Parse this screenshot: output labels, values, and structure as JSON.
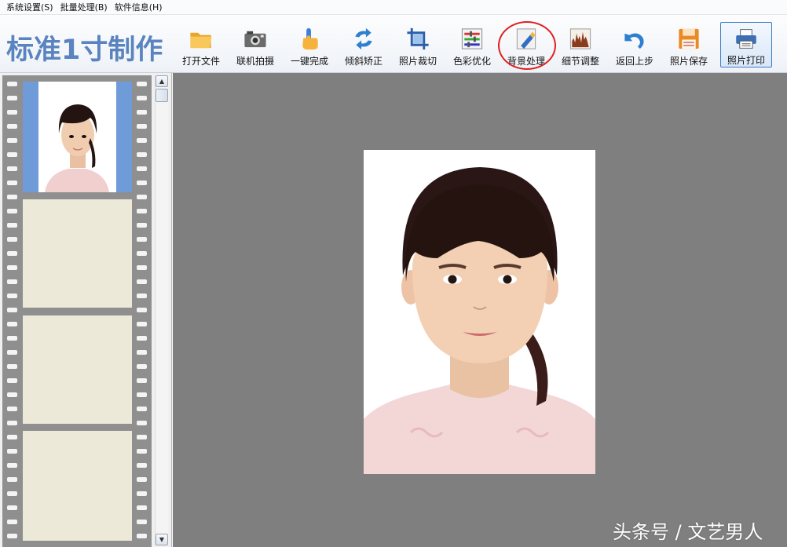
{
  "menu": {
    "items": [
      "系统设置(S)",
      "批量处理(B)",
      "软件信息(H)"
    ]
  },
  "toolbar": {
    "app_title": "标准1寸制作",
    "buttons": [
      {
        "label": "打开文件",
        "icon": "open-folder-icon"
      },
      {
        "label": "联机拍摄",
        "icon": "camera-icon"
      },
      {
        "label": "一键完成",
        "icon": "hand-pointer-icon"
      },
      {
        "label": "倾斜矫正",
        "icon": "rotate-arrows-icon"
      },
      {
        "label": "照片裁切",
        "icon": "crop-icon"
      },
      {
        "label": "色彩优化",
        "icon": "color-levels-icon"
      },
      {
        "label": "背景处理",
        "icon": "paint-brush-icon"
      },
      {
        "label": "细节调整",
        "icon": "histogram-icon"
      },
      {
        "label": "返回上步",
        "icon": "undo-arrow-icon"
      },
      {
        "label": "照片保存",
        "icon": "floppy-disk-icon"
      },
      {
        "label": "照片打印",
        "icon": "printer-icon"
      }
    ],
    "highlighted_button": "背景处理",
    "active_button": "照片打印"
  },
  "colors": {
    "title_blue": "#5a84bf",
    "thumb_background": "#6f9bd8",
    "canvas_gray": "#7f7f7f",
    "highlight_red": "#e02020"
  },
  "filmstrip": {
    "frame_count": 4,
    "filled_frames": 1
  },
  "watermark": "头条号 / 文艺男人"
}
